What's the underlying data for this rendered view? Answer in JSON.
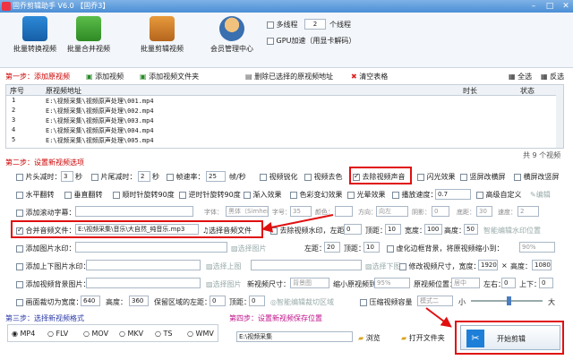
{
  "window": {
    "title": "固乔剪辑助手 V6.0 【固乔3】"
  },
  "toolbar": {
    "tools": [
      "批量转换视频",
      "批量合并视频",
      "批量剪辑视频",
      "会员管理中心"
    ],
    "multithread_label": "多线程",
    "thread_count": "2",
    "thread_unit": "个线程",
    "gpu_label": "GPU加速（用显卡解码）"
  },
  "step1": {
    "label": "第一步：添加原视频",
    "add_video": "添加视频",
    "add_folder": "添加视频文件夹",
    "delete_selected": "删除已选择的原视频地址",
    "clear": "清空表格",
    "select_all": "全选",
    "invert": "反选"
  },
  "grid": {
    "headers": {
      "index": "序号",
      "path": "原视频地址",
      "duration": "时长",
      "status": "状态"
    },
    "rows": [
      {
        "index": "1",
        "path": "E:\\视频采集\\视频原声处理\\001.mp4"
      },
      {
        "index": "2",
        "path": "E:\\视频采集\\视频原声处理\\002.mp4"
      },
      {
        "index": "3",
        "path": "E:\\视频采集\\视频原声处理\\003.mp4"
      },
      {
        "index": "4",
        "path": "E:\\视频采集\\视频原声处理\\004.mp4"
      },
      {
        "index": "5",
        "path": "E:\\视频采集\\视频原声处理\\005.mp4"
      }
    ],
    "total": "共 9 个视频"
  },
  "step2": {
    "label": "第二步：设置新视频选项",
    "head_cut": "片头减时：",
    "head_val": "3",
    "tail_cut": "片尾减时：",
    "tail_val": "2",
    "sec": "秒",
    "fps": "帧速率：",
    "fps_val": "25",
    "fps_unit": "帧/秒",
    "sharpen": "视频锐化",
    "vflip": "视频去色",
    "remove_audio": "去除视频声音",
    "glow": "闪光效果",
    "vmirror": "竖屏改横屏",
    "hmirror": "横屏改竖屏",
    "hflip": "水平翻转",
    "vertical_flip": "垂直翻转",
    "rot90": "顺时针旋转90度",
    "rot_ccw": "逆时针旋转90度",
    "fadein": "渐入效果",
    "color_var": "色彩变幻效果",
    "light": "光晕效果",
    "play_speed": "播放速度：",
    "speed_val": "0.7",
    "custom": "高级自定义",
    "edit": "编辑",
    "subtitle": "添加滚动字幕：",
    "font": "字体：",
    "font_val": "黑体（Simhei）",
    "size": "字号：",
    "size_val": "35",
    "color": "颜色：",
    "direction": "方向：",
    "dir_val": "向左",
    "shadow": "阴影：",
    "shadow_val": "0",
    "bottom": "底距：",
    "bottom_val": "30",
    "speed": "速度：",
    "speed2": "2",
    "merge_audio": "合并音频文件：",
    "audio_path": "E:\\视频采集\\音乐\\大自然_纯音乐.mp3",
    "pick_audio": "选择音频文件",
    "watermark_rm": "去除视频水印，左距：",
    "wm_left": "0",
    "top_dist": "顶距：",
    "wm_top": "10",
    "width": "宽度：",
    "wm_w": "100",
    "height": "高度：",
    "wm_h": "50",
    "smart_wm": "智能编辑水印位置",
    "img_watermark": "添加图片水印：",
    "pick_image": "选择图片",
    "left_dist": "左距：",
    "l_val": "20",
    "t_val": "10",
    "blur_bg": "虚化边框背景，将原视频缩小到：",
    "blur_val": "90%",
    "top_bottom": "添加上下图片水印：",
    "pick_top": "选择上图",
    "pick_bottom": "选择下图",
    "resize": "修改视频尺寸，宽度：",
    "res_w": "1920",
    "res_h": "1080",
    "res_height": "高度：",
    "bg_image": "添加视频背景图片：",
    "pick_bg": "选择图片",
    "new_size": "新视频尺寸：",
    "size_opt": "背景图",
    "shrink": "缩小原视频到：",
    "shrink_val": "95%",
    "pos": "原视频位置：",
    "pos_val": "居中",
    "lr": "左右：",
    "lr_val": "0",
    "tb": "上下：",
    "tb_val": "0",
    "crop": "画面裁切为宽度：",
    "crop_w": "640",
    "crop_h_lbl": "高度：",
    "crop_h": "360",
    "keep_left": "保留区域的左距：",
    "keep_l": "0",
    "keep_top": "顶距：",
    "keep_t": "0",
    "smart_crop": "智能编辑裁切区域",
    "compress": "压缩视频容量",
    "mode": "模式二",
    "size_small": "小",
    "size_big": "大"
  },
  "step3": {
    "label": "第三步：选择新视频格式",
    "formats": [
      "MP4",
      "FLV",
      "MOV",
      "MKV",
      "TS",
      "WMV"
    ]
  },
  "step4": {
    "label": "第四步：设置新视频保存位置",
    "save_path": "E:\\视频采集",
    "browse": "浏览",
    "open_folder": "打开文件夹",
    "start": "开始剪辑"
  }
}
